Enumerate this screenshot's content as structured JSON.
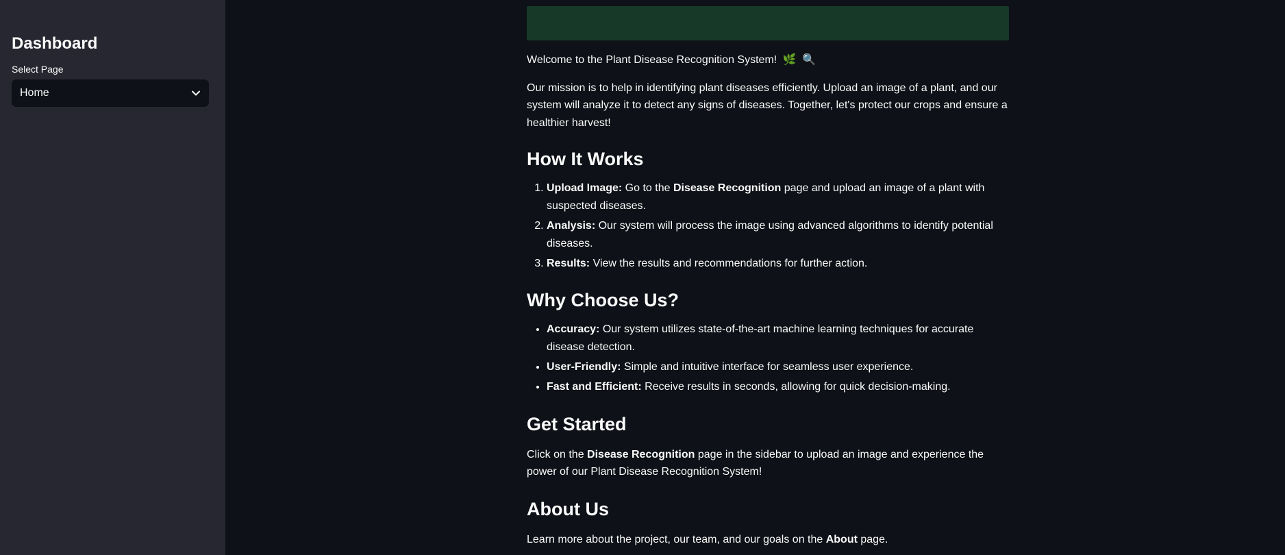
{
  "sidebar": {
    "title": "Dashboard",
    "select_label": "Select Page",
    "select_value": "Home"
  },
  "main": {
    "welcome": "Welcome to the Plant Disease Recognition System!",
    "welcome_emojis": [
      "🌿",
      "🔍"
    ],
    "mission": "Our mission is to help in identifying plant diseases efficiently. Upload an image of a plant, and our system will analyze it to detect any signs of diseases. Together, let's protect our crops and ensure a healthier harvest!",
    "how_heading": "How It Works",
    "how_steps": [
      {
        "label": "Upload Image:",
        "text_before": " Go to the ",
        "bold": "Disease Recognition",
        "text_after": " page and upload an image of a plant with suspected diseases."
      },
      {
        "label": "Analysis:",
        "text": " Our system will process the image using advanced algorithms to identify potential diseases."
      },
      {
        "label": "Results:",
        "text": " View the results and recommendations for further action."
      }
    ],
    "why_heading": "Why Choose Us?",
    "why_items": [
      {
        "label": "Accuracy:",
        "text": " Our system utilizes state-of-the-art machine learning techniques for accurate disease detection."
      },
      {
        "label": "User-Friendly:",
        "text": " Simple and intuitive interface for seamless user experience."
      },
      {
        "label": "Fast and Efficient:",
        "text": " Receive results in seconds, allowing for quick decision-making."
      }
    ],
    "get_heading": "Get Started",
    "get_text_before": "Click on the ",
    "get_bold": "Disease Recognition",
    "get_text_after": " page in the sidebar to upload an image and experience the power of our Plant Disease Recognition System!",
    "about_heading": "About Us",
    "about_text_before": "Learn more about the project, our team, and our goals on the ",
    "about_bold": "About",
    "about_text_after": " page."
  }
}
